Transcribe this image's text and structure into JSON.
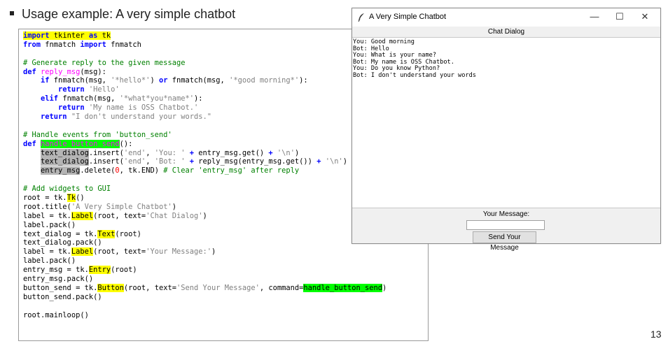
{
  "slide": {
    "heading": "Usage example: A very simple chatbot",
    "page_number": "13"
  },
  "code_lines": [
    [
      {
        "t": "import",
        "c": "t-kw hl-yellow"
      },
      {
        "t": " tkinter ",
        "c": "hl-yellow"
      },
      {
        "t": "as",
        "c": "t-kw hl-yellow"
      },
      {
        "t": " tk",
        "c": "hl-yellow"
      }
    ],
    [
      {
        "t": "from",
        "c": "t-kw"
      },
      {
        "t": " fnmatch "
      },
      {
        "t": "import",
        "c": "t-kw"
      },
      {
        "t": " fnmatch"
      }
    ],
    [],
    [
      {
        "t": "# Generate reply to the given message",
        "c": "t-cm"
      }
    ],
    [
      {
        "t": "def",
        "c": "t-def"
      },
      {
        "t": " "
      },
      {
        "t": "reply_msg",
        "c": "t-fn"
      },
      {
        "t": "(msg):"
      }
    ],
    [
      {
        "t": "    "
      },
      {
        "t": "if",
        "c": "t-kw"
      },
      {
        "t": " fnmatch(msg, "
      },
      {
        "t": "'*hello*'",
        "c": "t-str"
      },
      {
        "t": ") "
      },
      {
        "t": "or",
        "c": "t-kw"
      },
      {
        "t": " fnmatch(msg, "
      },
      {
        "t": "'*good morning*'",
        "c": "t-str"
      },
      {
        "t": "):"
      }
    ],
    [
      {
        "t": "        "
      },
      {
        "t": "return",
        "c": "t-kw"
      },
      {
        "t": " "
      },
      {
        "t": "'Hello'",
        "c": "t-str"
      }
    ],
    [
      {
        "t": "    "
      },
      {
        "t": "elif",
        "c": "t-kw"
      },
      {
        "t": " fnmatch(msg, "
      },
      {
        "t": "'*what*you*name*'",
        "c": "t-str"
      },
      {
        "t": "):"
      }
    ],
    [
      {
        "t": "        "
      },
      {
        "t": "return",
        "c": "t-kw"
      },
      {
        "t": " "
      },
      {
        "t": "'My name is OSS Chatbot.'",
        "c": "t-str"
      }
    ],
    [
      {
        "t": "    "
      },
      {
        "t": "return",
        "c": "t-kw"
      },
      {
        "t": " "
      },
      {
        "t": "\"I don't understand your words.\"",
        "c": "t-str"
      }
    ],
    [],
    [
      {
        "t": "# Handle events from 'button_send'",
        "c": "t-cm"
      }
    ],
    [
      {
        "t": "def",
        "c": "t-def"
      },
      {
        "t": " "
      },
      {
        "t": "handle_button_send",
        "c": "t-fn hl-green"
      },
      {
        "t": "():"
      }
    ],
    [
      {
        "t": "    "
      },
      {
        "t": "text_dialog",
        "c": "hl-grey"
      },
      {
        "t": ".insert("
      },
      {
        "t": "'end'",
        "c": "t-str"
      },
      {
        "t": ", "
      },
      {
        "t": "'You: '",
        "c": "t-str"
      },
      {
        "t": " "
      },
      {
        "t": "+",
        "c": "t-op"
      },
      {
        "t": " entry_msg.get() "
      },
      {
        "t": "+",
        "c": "t-op"
      },
      {
        "t": " "
      },
      {
        "t": "'\\n'",
        "c": "t-str"
      },
      {
        "t": ")"
      }
    ],
    [
      {
        "t": "    "
      },
      {
        "t": "text_dialog",
        "c": "hl-grey"
      },
      {
        "t": ".insert("
      },
      {
        "t": "'end'",
        "c": "t-str"
      },
      {
        "t": ", "
      },
      {
        "t": "'Bot: '",
        "c": "t-str"
      },
      {
        "t": " "
      },
      {
        "t": "+",
        "c": "t-op"
      },
      {
        "t": " reply_msg(entry_msg.get()) "
      },
      {
        "t": "+",
        "c": "t-op"
      },
      {
        "t": " "
      },
      {
        "t": "'\\n'",
        "c": "t-str"
      },
      {
        "t": ")"
      }
    ],
    [
      {
        "t": "    "
      },
      {
        "t": "entry_msg",
        "c": "hl-grey"
      },
      {
        "t": ".delete("
      },
      {
        "t": "0",
        "c": "t-num"
      },
      {
        "t": ", tk.END) "
      },
      {
        "t": "# Clear 'entry_msg' after reply",
        "c": "t-cm"
      }
    ],
    [],
    [
      {
        "t": "# Add widgets to GUI",
        "c": "t-cm"
      }
    ],
    [
      {
        "t": "root = tk."
      },
      {
        "t": "Tk",
        "c": "hl-yellow"
      },
      {
        "t": "()"
      }
    ],
    [
      {
        "t": "root.title("
      },
      {
        "t": "'A Very Simple Chatbot'",
        "c": "t-str"
      },
      {
        "t": ")"
      }
    ],
    [
      {
        "t": "label = tk."
      },
      {
        "t": "Label",
        "c": "hl-yellow"
      },
      {
        "t": "(root, text="
      },
      {
        "t": "'Chat Dialog'",
        "c": "t-str"
      },
      {
        "t": ")"
      }
    ],
    [
      {
        "t": "label.pack()"
      }
    ],
    [
      {
        "t": "text_dialog = tk."
      },
      {
        "t": "Text",
        "c": "hl-yellow"
      },
      {
        "t": "(root)"
      }
    ],
    [
      {
        "t": "text_dialog.pack()"
      }
    ],
    [
      {
        "t": "label = tk."
      },
      {
        "t": "Label",
        "c": "hl-yellow"
      },
      {
        "t": "(root, text="
      },
      {
        "t": "'Your Message:'",
        "c": "t-str"
      },
      {
        "t": ")"
      }
    ],
    [
      {
        "t": "label.pack()"
      }
    ],
    [
      {
        "t": "entry_msg = tk."
      },
      {
        "t": "Entry",
        "c": "hl-yellow"
      },
      {
        "t": "(root)"
      }
    ],
    [
      {
        "t": "entry_msg.pack()"
      }
    ],
    [
      {
        "t": "button_send = tk."
      },
      {
        "t": "Button",
        "c": "hl-yellow"
      },
      {
        "t": "(root, text="
      },
      {
        "t": "'Send Your Message'",
        "c": "t-str"
      },
      {
        "t": ", command="
      },
      {
        "t": "handle_button_send",
        "c": "hl-green"
      },
      {
        "t": ")"
      }
    ],
    [
      {
        "t": "button_send.pack()"
      }
    ],
    [],
    [
      {
        "t": "root.mainloop()"
      }
    ]
  ],
  "tk_window": {
    "title": "A Very Simple Chatbot",
    "minimize_glyph": "—",
    "maximize_glyph": "☐",
    "close_glyph": "✕",
    "chat_label": "Chat Dialog",
    "chat_lines": [
      "You: Good morning",
      "Bot: Hello",
      "You: What is your name?",
      "Bot: My name is OSS Chatbot.",
      "You: Do you know Python?",
      "Bot: I don't understand your words"
    ],
    "message_label": "Your Message:",
    "entry_value": "",
    "send_button_label": "Send Your Message",
    "icon": "feather-icon"
  }
}
